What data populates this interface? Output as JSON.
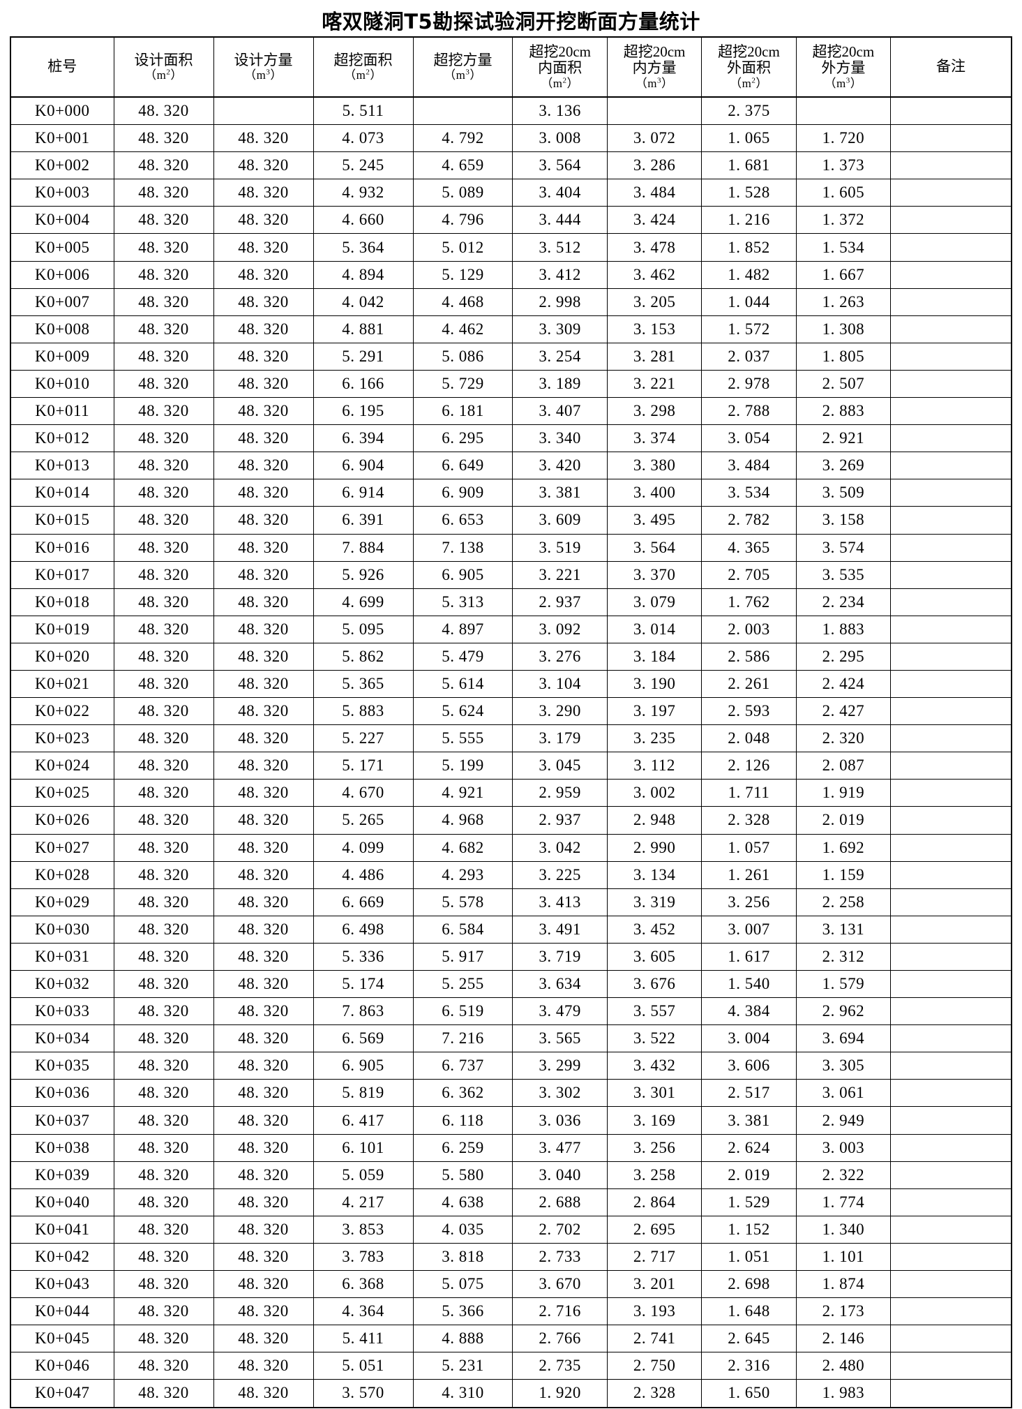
{
  "document": {
    "title": "喀双隧洞T5勘探试验洞开挖断面方量统计"
  },
  "table": {
    "columns": [
      {
        "key": "pile",
        "main": "桩号",
        "unit": "",
        "unit_sup": "",
        "has_unit": false
      },
      {
        "key": "design_area",
        "main": "设计面积",
        "unit": "m",
        "unit_sup": "2",
        "has_unit": true
      },
      {
        "key": "design_vol",
        "main": "设计方量",
        "unit": "m",
        "unit_sup": "3",
        "has_unit": true
      },
      {
        "key": "over_area",
        "main": "超挖面积",
        "unit": "m",
        "unit_sup": "2",
        "has_unit": true
      },
      {
        "key": "over_vol",
        "main": "超挖方量",
        "unit": "m",
        "unit_sup": "3",
        "has_unit": true
      },
      {
        "key": "in_area",
        "main": "超挖20cm",
        "main2": "内面积",
        "unit": "m",
        "unit_sup": "2",
        "has_unit": true
      },
      {
        "key": "in_vol",
        "main": "超挖20cm",
        "main2": "内方量",
        "unit": "m",
        "unit_sup": "3",
        "has_unit": true
      },
      {
        "key": "out_area",
        "main": "超挖20cm",
        "main2": "外面积",
        "unit": "m",
        "unit_sup": "2",
        "has_unit": true
      },
      {
        "key": "out_vol",
        "main": "超挖20cm",
        "main2": "外方量",
        "unit": "m",
        "unit_sup": "3",
        "has_unit": true
      },
      {
        "key": "remark",
        "main": "备注",
        "unit": "",
        "unit_sup": "",
        "has_unit": false
      }
    ],
    "rows": [
      [
        "K0+000",
        "48. 320",
        "",
        "5. 511",
        "",
        "3. 136",
        "",
        "2. 375",
        "",
        ""
      ],
      [
        "K0+001",
        "48. 320",
        "48. 320",
        "4. 073",
        "4. 792",
        "3. 008",
        "3. 072",
        "1. 065",
        "1. 720",
        ""
      ],
      [
        "K0+002",
        "48. 320",
        "48. 320",
        "5. 245",
        "4. 659",
        "3. 564",
        "3. 286",
        "1. 681",
        "1. 373",
        ""
      ],
      [
        "K0+003",
        "48. 320",
        "48. 320",
        "4. 932",
        "5. 089",
        "3. 404",
        "3. 484",
        "1. 528",
        "1. 605",
        ""
      ],
      [
        "K0+004",
        "48. 320",
        "48. 320",
        "4. 660",
        "4. 796",
        "3. 444",
        "3. 424",
        "1. 216",
        "1. 372",
        ""
      ],
      [
        "K0+005",
        "48. 320",
        "48. 320",
        "5. 364",
        "5. 012",
        "3. 512",
        "3. 478",
        "1. 852",
        "1. 534",
        ""
      ],
      [
        "K0+006",
        "48. 320",
        "48. 320",
        "4. 894",
        "5. 129",
        "3. 412",
        "3. 462",
        "1. 482",
        "1. 667",
        ""
      ],
      [
        "K0+007",
        "48. 320",
        "48. 320",
        "4. 042",
        "4. 468",
        "2. 998",
        "3. 205",
        "1. 044",
        "1. 263",
        ""
      ],
      [
        "K0+008",
        "48. 320",
        "48. 320",
        "4. 881",
        "4. 462",
        "3. 309",
        "3. 153",
        "1. 572",
        "1. 308",
        ""
      ],
      [
        "K0+009",
        "48. 320",
        "48. 320",
        "5. 291",
        "5. 086",
        "3. 254",
        "3. 281",
        "2. 037",
        "1. 805",
        ""
      ],
      [
        "K0+010",
        "48. 320",
        "48. 320",
        "6. 166",
        "5. 729",
        "3. 189",
        "3. 221",
        "2. 978",
        "2. 507",
        ""
      ],
      [
        "K0+011",
        "48. 320",
        "48. 320",
        "6. 195",
        "6. 181",
        "3. 407",
        "3. 298",
        "2. 788",
        "2. 883",
        ""
      ],
      [
        "K0+012",
        "48. 320",
        "48. 320",
        "6. 394",
        "6. 295",
        "3. 340",
        "3. 374",
        "3. 054",
        "2. 921",
        ""
      ],
      [
        "K0+013",
        "48. 320",
        "48. 320",
        "6. 904",
        "6. 649",
        "3. 420",
        "3. 380",
        "3. 484",
        "3. 269",
        ""
      ],
      [
        "K0+014",
        "48. 320",
        "48. 320",
        "6. 914",
        "6. 909",
        "3. 381",
        "3. 400",
        "3. 534",
        "3. 509",
        ""
      ],
      [
        "K0+015",
        "48. 320",
        "48. 320",
        "6. 391",
        "6. 653",
        "3. 609",
        "3. 495",
        "2. 782",
        "3. 158",
        ""
      ],
      [
        "K0+016",
        "48. 320",
        "48. 320",
        "7. 884",
        "7. 138",
        "3. 519",
        "3. 564",
        "4. 365",
        "3. 574",
        ""
      ],
      [
        "K0+017",
        "48. 320",
        "48. 320",
        "5. 926",
        "6. 905",
        "3. 221",
        "3. 370",
        "2. 705",
        "3. 535",
        ""
      ],
      [
        "K0+018",
        "48. 320",
        "48. 320",
        "4. 699",
        "5. 313",
        "2. 937",
        "3. 079",
        "1. 762",
        "2. 234",
        ""
      ],
      [
        "K0+019",
        "48. 320",
        "48. 320",
        "5. 095",
        "4. 897",
        "3. 092",
        "3. 014",
        "2. 003",
        "1. 883",
        ""
      ],
      [
        "K0+020",
        "48. 320",
        "48. 320",
        "5. 862",
        "5. 479",
        "3. 276",
        "3. 184",
        "2. 586",
        "2. 295",
        ""
      ],
      [
        "K0+021",
        "48. 320",
        "48. 320",
        "5. 365",
        "5. 614",
        "3. 104",
        "3. 190",
        "2. 261",
        "2. 424",
        ""
      ],
      [
        "K0+022",
        "48. 320",
        "48. 320",
        "5. 883",
        "5. 624",
        "3. 290",
        "3. 197",
        "2. 593",
        "2. 427",
        ""
      ],
      [
        "K0+023",
        "48. 320",
        "48. 320",
        "5. 227",
        "5. 555",
        "3. 179",
        "3. 235",
        "2. 048",
        "2. 320",
        ""
      ],
      [
        "K0+024",
        "48. 320",
        "48. 320",
        "5. 171",
        "5. 199",
        "3. 045",
        "3. 112",
        "2. 126",
        "2. 087",
        ""
      ],
      [
        "K0+025",
        "48. 320",
        "48. 320",
        "4. 670",
        "4. 921",
        "2. 959",
        "3. 002",
        "1. 711",
        "1. 919",
        ""
      ],
      [
        "K0+026",
        "48. 320",
        "48. 320",
        "5. 265",
        "4. 968",
        "2. 937",
        "2. 948",
        "2. 328",
        "2. 019",
        ""
      ],
      [
        "K0+027",
        "48. 320",
        "48. 320",
        "4. 099",
        "4. 682",
        "3. 042",
        "2. 990",
        "1. 057",
        "1. 692",
        ""
      ],
      [
        "K0+028",
        "48. 320",
        "48. 320",
        "4. 486",
        "4. 293",
        "3. 225",
        "3. 134",
        "1. 261",
        "1. 159",
        ""
      ],
      [
        "K0+029",
        "48. 320",
        "48. 320",
        "6. 669",
        "5. 578",
        "3. 413",
        "3. 319",
        "3. 256",
        "2. 258",
        ""
      ],
      [
        "K0+030",
        "48. 320",
        "48. 320",
        "6. 498",
        "6. 584",
        "3. 491",
        "3. 452",
        "3. 007",
        "3. 131",
        ""
      ],
      [
        "K0+031",
        "48. 320",
        "48. 320",
        "5. 336",
        "5. 917",
        "3. 719",
        "3. 605",
        "1. 617",
        "2. 312",
        ""
      ],
      [
        "K0+032",
        "48. 320",
        "48. 320",
        "5. 174",
        "5. 255",
        "3. 634",
        "3. 676",
        "1. 540",
        "1. 579",
        ""
      ],
      [
        "K0+033",
        "48. 320",
        "48. 320",
        "7. 863",
        "6. 519",
        "3. 479",
        "3. 557",
        "4. 384",
        "2. 962",
        ""
      ],
      [
        "K0+034",
        "48. 320",
        "48. 320",
        "6. 569",
        "7. 216",
        "3. 565",
        "3. 522",
        "3. 004",
        "3. 694",
        ""
      ],
      [
        "K0+035",
        "48. 320",
        "48. 320",
        "6. 905",
        "6. 737",
        "3. 299",
        "3. 432",
        "3. 606",
        "3. 305",
        ""
      ],
      [
        "K0+036",
        "48. 320",
        "48. 320",
        "5. 819",
        "6. 362",
        "3. 302",
        "3. 301",
        "2. 517",
        "3. 061",
        ""
      ],
      [
        "K0+037",
        "48. 320",
        "48. 320",
        "6. 417",
        "6. 118",
        "3. 036",
        "3. 169",
        "3. 381",
        "2. 949",
        ""
      ],
      [
        "K0+038",
        "48. 320",
        "48. 320",
        "6. 101",
        "6. 259",
        "3. 477",
        "3. 256",
        "2. 624",
        "3. 003",
        ""
      ],
      [
        "K0+039",
        "48. 320",
        "48. 320",
        "5. 059",
        "5. 580",
        "3. 040",
        "3. 258",
        "2. 019",
        "2. 322",
        ""
      ],
      [
        "K0+040",
        "48. 320",
        "48. 320",
        "4. 217",
        "4. 638",
        "2. 688",
        "2. 864",
        "1. 529",
        "1. 774",
        ""
      ],
      [
        "K0+041",
        "48. 320",
        "48. 320",
        "3. 853",
        "4. 035",
        "2. 702",
        "2. 695",
        "1. 152",
        "1. 340",
        ""
      ],
      [
        "K0+042",
        "48. 320",
        "48. 320",
        "3. 783",
        "3. 818",
        "2. 733",
        "2. 717",
        "1. 051",
        "1. 101",
        ""
      ],
      [
        "K0+043",
        "48. 320",
        "48. 320",
        "6. 368",
        "5. 075",
        "3. 670",
        "3. 201",
        "2. 698",
        "1. 874",
        ""
      ],
      [
        "K0+044",
        "48. 320",
        "48. 320",
        "4. 364",
        "5. 366",
        "2. 716",
        "3. 193",
        "1. 648",
        "2. 173",
        ""
      ],
      [
        "K0+045",
        "48. 320",
        "48. 320",
        "5. 411",
        "4. 888",
        "2. 766",
        "2. 741",
        "2. 645",
        "2. 146",
        ""
      ],
      [
        "K0+046",
        "48. 320",
        "48. 320",
        "5. 051",
        "5. 231",
        "2. 735",
        "2. 750",
        "2. 316",
        "2. 480",
        ""
      ],
      [
        "K0+047",
        "48. 320",
        "48. 320",
        "3. 570",
        "4. 310",
        "1. 920",
        "2. 328",
        "1. 650",
        "1. 983",
        ""
      ]
    ]
  },
  "chart_data": {
    "type": "table",
    "title": "喀双隧洞T5勘探试验洞开挖断面方量统计",
    "columns": [
      "桩号",
      "设计面积(m2)",
      "设计方量(m3)",
      "超挖面积(m2)",
      "超挖方量(m3)",
      "超挖20cm内面积(m2)",
      "超挖20cm内方量(m3)",
      "超挖20cm外面积(m2)",
      "超挖20cm外方量(m3)",
      "备注"
    ],
    "row_count": 48,
    "design_area_constant": 48.32,
    "design_volume_constant": 48.32,
    "over_area": [
      5.511,
      4.073,
      5.245,
      4.932,
      4.66,
      5.364,
      4.894,
      4.042,
      4.881,
      5.291,
      6.166,
      6.195,
      6.394,
      6.904,
      6.914,
      6.391,
      7.884,
      5.926,
      4.699,
      5.095,
      5.862,
      5.365,
      5.883,
      5.227,
      5.171,
      4.67,
      5.265,
      4.099,
      4.486,
      6.669,
      6.498,
      5.336,
      5.174,
      7.863,
      6.569,
      6.905,
      5.819,
      6.417,
      6.101,
      5.059,
      4.217,
      3.853,
      3.783,
      6.368,
      4.364,
      5.411,
      5.051,
      3.57
    ],
    "over_volume": [
      null,
      4.792,
      4.659,
      5.089,
      4.796,
      5.012,
      5.129,
      4.468,
      4.462,
      5.086,
      5.729,
      6.181,
      6.295,
      6.649,
      6.909,
      6.653,
      7.138,
      6.905,
      5.313,
      4.897,
      5.479,
      5.614,
      5.624,
      5.555,
      5.199,
      4.921,
      4.968,
      4.682,
      4.293,
      5.578,
      6.584,
      5.917,
      5.255,
      6.519,
      7.216,
      6.737,
      6.362,
      6.118,
      6.259,
      5.58,
      4.638,
      4.035,
      3.818,
      5.075,
      5.366,
      4.888,
      5.231,
      4.31
    ],
    "inner_area": [
      3.136,
      3.008,
      3.564,
      3.404,
      3.444,
      3.512,
      3.412,
      2.998,
      3.309,
      3.254,
      3.189,
      3.407,
      3.34,
      3.42,
      3.381,
      3.609,
      3.519,
      3.221,
      2.937,
      3.092,
      3.276,
      3.104,
      3.29,
      3.179,
      3.045,
      2.959,
      2.937,
      3.042,
      3.225,
      3.413,
      3.491,
      3.719,
      3.634,
      3.479,
      3.565,
      3.299,
      3.302,
      3.036,
      3.477,
      3.04,
      2.688,
      2.702,
      2.733,
      3.67,
      2.716,
      2.766,
      2.735,
      1.92
    ],
    "inner_volume": [
      null,
      3.072,
      3.286,
      3.484,
      3.424,
      3.478,
      3.462,
      3.205,
      3.153,
      3.281,
      3.221,
      3.298,
      3.374,
      3.38,
      3.4,
      3.495,
      3.564,
      3.37,
      3.079,
      3.014,
      3.184,
      3.19,
      3.197,
      3.235,
      3.112,
      3.002,
      2.948,
      2.99,
      3.134,
      3.319,
      3.452,
      3.605,
      3.676,
      3.557,
      3.522,
      3.432,
      3.301,
      3.169,
      3.256,
      3.258,
      2.864,
      2.695,
      2.717,
      3.201,
      3.193,
      2.741,
      2.75,
      2.328
    ],
    "outer_area": [
      2.375,
      1.065,
      1.681,
      1.528,
      1.216,
      1.852,
      1.482,
      1.044,
      1.572,
      2.037,
      2.978,
      2.788,
      3.054,
      3.484,
      3.534,
      2.782,
      4.365,
      2.705,
      1.762,
      2.003,
      2.586,
      2.261,
      2.593,
      2.048,
      2.126,
      1.711,
      2.328,
      1.057,
      1.261,
      3.256,
      3.007,
      1.617,
      1.54,
      4.384,
      3.004,
      3.606,
      2.517,
      3.381,
      2.624,
      2.019,
      1.529,
      1.152,
      1.051,
      2.698,
      1.648,
      2.645,
      2.316,
      1.65
    ],
    "outer_volume": [
      null,
      1.72,
      1.373,
      1.605,
      1.372,
      1.534,
      1.667,
      1.263,
      1.308,
      1.805,
      2.507,
      2.883,
      2.921,
      3.269,
      3.509,
      3.158,
      3.574,
      3.535,
      2.234,
      1.883,
      2.295,
      2.424,
      2.427,
      2.32,
      2.087,
      1.919,
      2.019,
      1.692,
      1.159,
      2.258,
      3.131,
      2.312,
      1.579,
      2.962,
      3.694,
      3.305,
      3.061,
      2.949,
      3.003,
      2.322,
      1.774,
      1.34,
      1.101,
      1.874,
      2.173,
      2.146,
      2.48,
      1.983
    ],
    "stations": [
      "K0+000",
      "K0+001",
      "K0+002",
      "K0+003",
      "K0+004",
      "K0+005",
      "K0+006",
      "K0+007",
      "K0+008",
      "K0+009",
      "K0+010",
      "K0+011",
      "K0+012",
      "K0+013",
      "K0+014",
      "K0+015",
      "K0+016",
      "K0+017",
      "K0+018",
      "K0+019",
      "K0+020",
      "K0+021",
      "K0+022",
      "K0+023",
      "K0+024",
      "K0+025",
      "K0+026",
      "K0+027",
      "K0+028",
      "K0+029",
      "K0+030",
      "K0+031",
      "K0+032",
      "K0+033",
      "K0+034",
      "K0+035",
      "K0+036",
      "K0+037",
      "K0+038",
      "K0+039",
      "K0+040",
      "K0+041",
      "K0+042",
      "K0+043",
      "K0+044",
      "K0+045",
      "K0+046",
      "K0+047"
    ]
  }
}
